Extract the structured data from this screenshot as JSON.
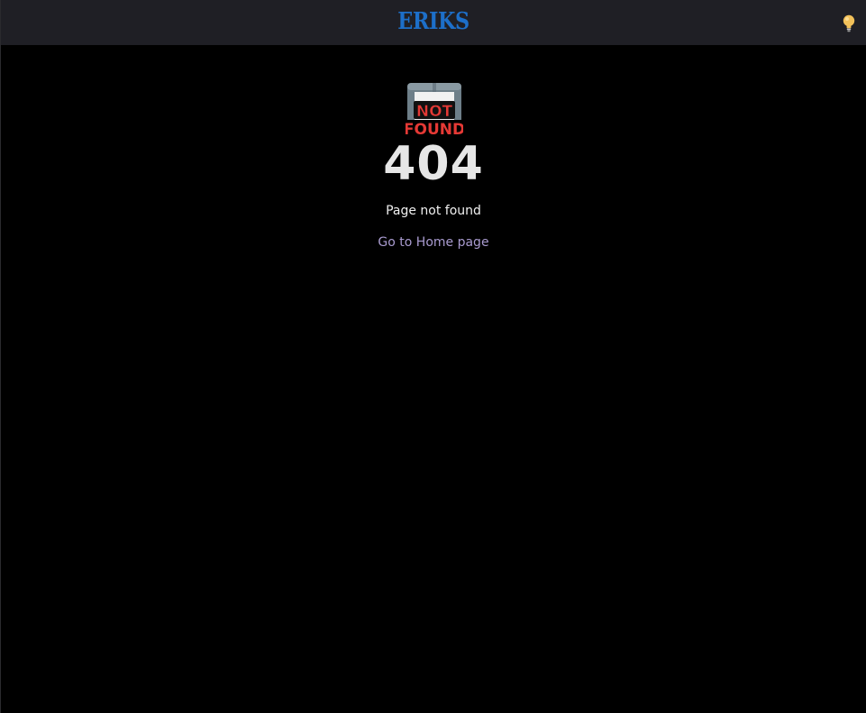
{
  "header": {
    "brand": "ERIKS",
    "theme_toggle_icon": "lightbulb-icon"
  },
  "main": {
    "illustration": {
      "icon": "not-found-phone-icon",
      "line1": "NOT",
      "line2": "FOUND"
    },
    "code": "404",
    "message": "Page not found",
    "home_link": "Go to Home page"
  },
  "colors": {
    "background": "#000000",
    "header_background": "#1f1f25",
    "brand": "#1d6fc9",
    "code_text": "#e6e6e6",
    "link": "#a99bd0",
    "not_found_red": "#e53935"
  }
}
